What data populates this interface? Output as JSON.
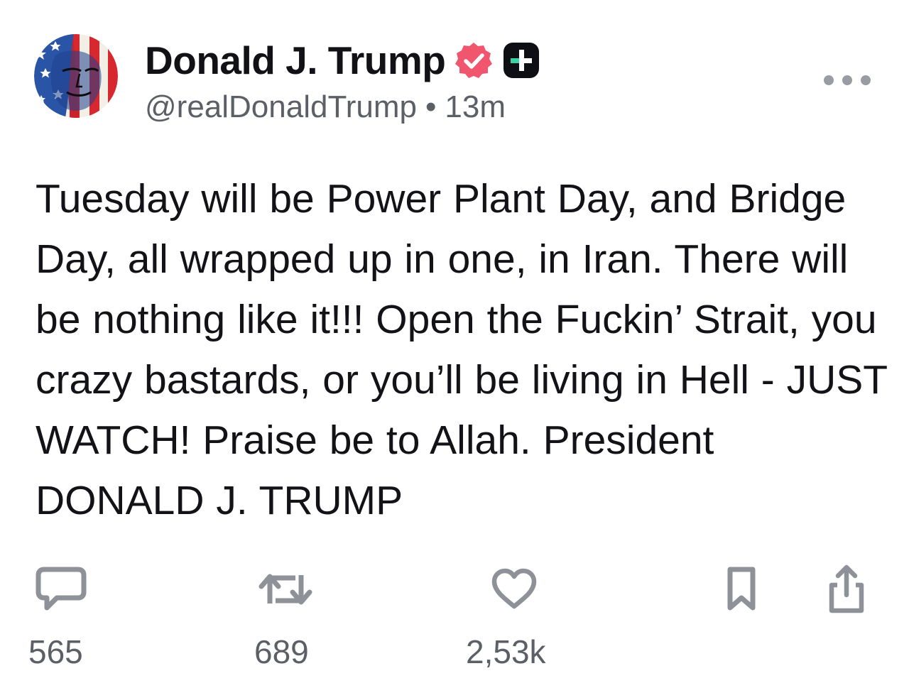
{
  "post": {
    "author": {
      "display_name": "Donald J. Trump",
      "handle": "@realDonaldTrump",
      "separator": "•",
      "time_ago": "13m",
      "verified": true,
      "avatar_icon": "flag-portrait-avatar"
    },
    "body": "Tuesday will be Power Plant Day, and Bridge Day, all wrapped up in one, in Iran. There will be nothing like it!!! Open the Fuckin’ Strait, you crazy bastards, or you’ll be living in Hell - JUST WATCH! Praise be to Allah. President DONALD J. TRUMP",
    "actions": {
      "reply": {
        "icon": "speech-bubble-icon",
        "count": "565"
      },
      "repost": {
        "icon": "repost-arrows-icon",
        "count": "689"
      },
      "like": {
        "icon": "heart-icon",
        "count": "2,53k"
      },
      "bookmark": {
        "icon": "bookmark-icon"
      },
      "share": {
        "icon": "share-icon"
      }
    },
    "more_icon": "ellipsis-icon"
  },
  "colors": {
    "text_primary": "#121217",
    "text_secondary": "#5c5f66",
    "icon_gray": "#8e9197",
    "verified_badge": "#f0566e",
    "plus_badge_bg": "#0e0f14",
    "plus_badge_accent": "#39d3a5"
  }
}
